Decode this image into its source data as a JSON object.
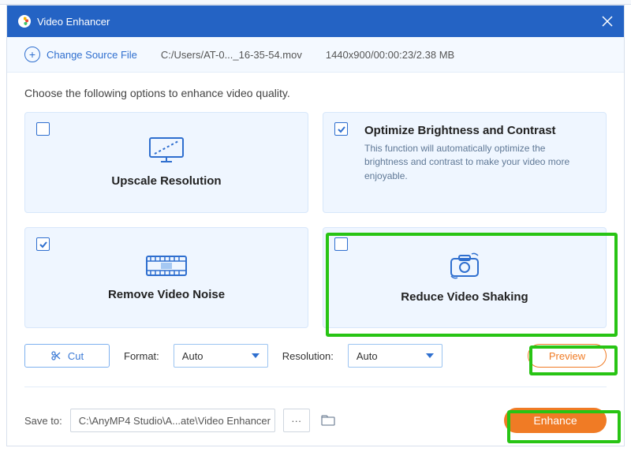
{
  "titlebar": {
    "title": "Video Enhancer"
  },
  "sourcebar": {
    "change_label": "Change Source File",
    "path": "C:/Users/AT-0..._16-35-54.mov",
    "info": "1440x900/00:00:23/2.38 MB"
  },
  "instruction": "Choose the following options to enhance video quality.",
  "cards": {
    "upscale": {
      "title": "Upscale Resolution",
      "checked": false
    },
    "brightness": {
      "title": "Optimize Brightness and Contrast",
      "desc": "This function will automatically optimize the brightness and contrast to make your video more enjoyable.",
      "checked": true
    },
    "denoise": {
      "title": "Remove Video Noise",
      "checked": true
    },
    "deshake": {
      "title": "Reduce Video Shaking",
      "checked": false
    }
  },
  "toolrow": {
    "cut_label": "Cut",
    "format_label": "Format:",
    "format_value": "Auto",
    "resolution_label": "Resolution:",
    "resolution_value": "Auto",
    "preview_label": "Preview"
  },
  "footer": {
    "saveto_label": "Save to:",
    "path": "C:\\AnyMP4 Studio\\A...ate\\Video Enhancer",
    "dots": "···",
    "enhance_label": "Enhance"
  },
  "colors": {
    "accent": "#2f6fcf",
    "orange": "#f07b25",
    "cardbg": "#eff6ff"
  }
}
